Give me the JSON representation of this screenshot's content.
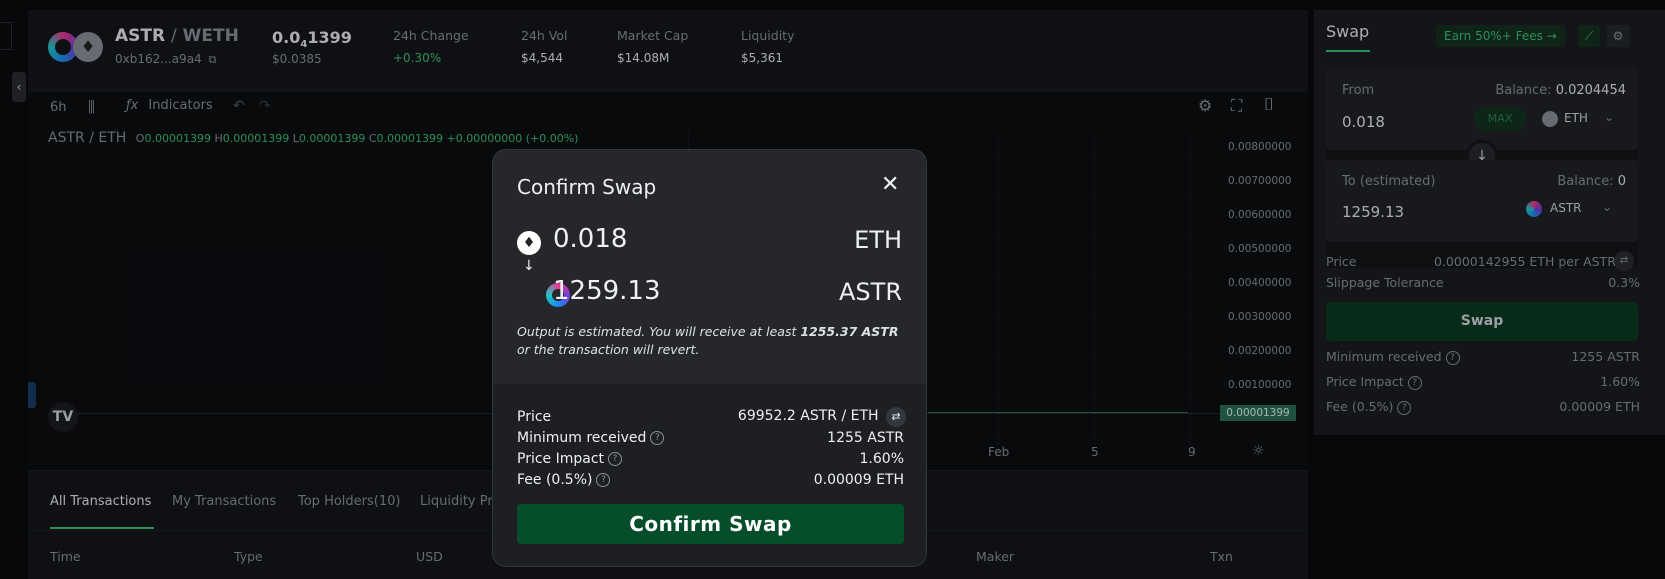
{
  "header": {
    "pair_base": "ASTR",
    "pair_sep": "/",
    "pair_quote": "WETH",
    "address": "0xb162...a9a4",
    "price_prefix": "0.0",
    "price_sub": "4",
    "price_rest": "1399",
    "price_usd": "$0.0385",
    "stats": [
      {
        "label": "24h Change",
        "value": "+0.30%"
      },
      {
        "label": "24h Vol",
        "value": "$4,544"
      },
      {
        "label": "Market Cap",
        "value": "$14.08M"
      },
      {
        "label": "Liquidity",
        "value": "$5,361"
      }
    ]
  },
  "toolbar": {
    "interval": "6h",
    "indicators": "Indicators"
  },
  "chart": {
    "symbol": "ASTR / ETH",
    "ohlc_o_label": "O",
    "ohlc_o": "0.00001399",
    "ohlc_h_label": "H",
    "ohlc_h": "0.00001399",
    "ohlc_l_label": "L",
    "ohlc_l": "0.00001399",
    "ohlc_c_label": "C",
    "ohlc_c": "0.00001399",
    "ohlc_change": "+0.00000000 (+0.00%)",
    "y_ticks": [
      "0.00800000",
      "0.00700000",
      "0.00600000",
      "0.00500000",
      "0.00400000",
      "0.00300000",
      "0.00200000",
      "0.00100000"
    ],
    "last_price": "0.00001399",
    "x_ticks": [
      "Feb",
      "5",
      "9"
    ]
  },
  "tabs": [
    "All Transactions",
    "My Transactions",
    "Top Holders(10)",
    "Liquidity Pr"
  ],
  "table_headers": [
    "Time",
    "Type",
    "USD",
    "Maker",
    "Txn"
  ],
  "side": {
    "title": "Swap",
    "earn": "Earn 50%+ Fees →",
    "from_label": "From",
    "from_balance_label": "Balance:",
    "from_balance": "0.0204454",
    "from_amount": "0.018",
    "max": "MAX",
    "from_token": "ETH",
    "to_label": "To (estimated)",
    "to_balance_label": "Balance:",
    "to_balance": "0",
    "to_amount": "1259.13",
    "to_token": "ASTR",
    "price_label": "Price",
    "price_value": "0.0000142955 ETH per ASTR",
    "slippage_label": "Slippage Tolerance",
    "slippage_value": "0.3%",
    "swap_button": "Swap",
    "min_received_label": "Minimum received",
    "min_received": "1255 ASTR",
    "price_impact_label": "Price Impact",
    "price_impact": "1.60%",
    "fee_label": "Fee (0.5%)",
    "fee": "0.00009 ETH"
  },
  "modal": {
    "title": "Confirm Swap",
    "from_amount": "0.018",
    "from_token": "ETH",
    "to_amount": "1259.13",
    "to_token": "ASTR",
    "note_pre": "Output is estimated. You will receive at least",
    "note_bold": "1255.37 ASTR",
    "note_post": "or the transaction will revert.",
    "price_label": "Price",
    "price_value": "69952.2 ASTR / ETH",
    "min_received_label": "Minimum received",
    "min_received": "1255 ASTR",
    "price_impact_label": "Price Impact",
    "price_impact": "1.60%",
    "fee_label": "Fee (0.5%)",
    "fee": "0.00009 ETH",
    "confirm_button": "Confirm Swap"
  },
  "colors": {
    "accent_green": "#3bbf78",
    "button_green": "#064d2a"
  }
}
